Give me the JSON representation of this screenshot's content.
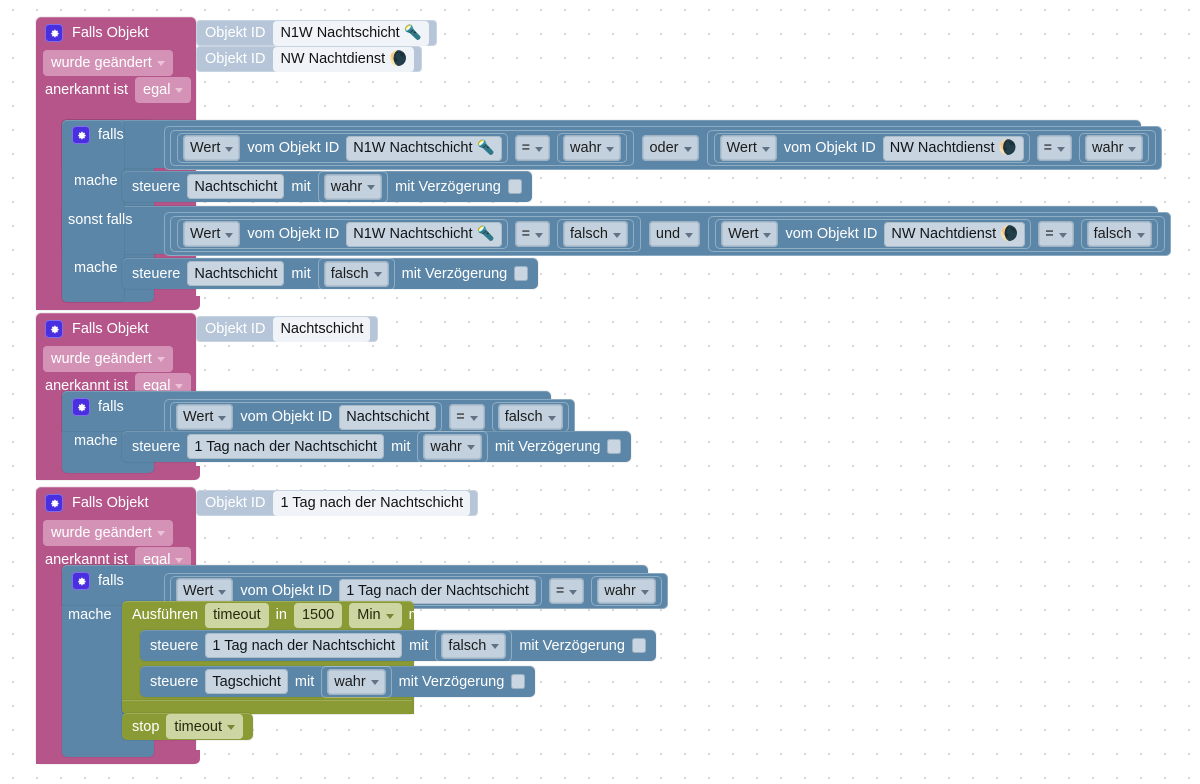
{
  "app": {
    "kind": "blockly-visual-script-editor",
    "language": "de",
    "colors": {
      "event_block": "#b5558a",
      "control_block": "#5b86a7",
      "timing_block": "#8a9b35",
      "object_block": "#b6c6d8",
      "gear_icon": "#4a2fe0",
      "canvas": "#ffffff"
    }
  },
  "labels": {
    "falls_objekt": "Falls Objekt",
    "objekt_id": "Objekt ID",
    "wurde_geaendert": "wurde geändert",
    "anerkannt_ist": "anerkannt ist",
    "falls": "falls",
    "sonst_falls": "sonst falls",
    "mache": "mache",
    "wert": "Wert",
    "vom_objekt_id": "vom Objekt ID",
    "steuere": "steuere",
    "mit": "mit",
    "mit_verzoegerung": "mit Verzögerung",
    "ausfuehren": "Ausführen",
    "in": "in",
    "ms": "ms",
    "stop": "stop",
    "egal": "egal",
    "wahr": "wahr",
    "falsch": "falsch",
    "oder": "oder",
    "und": "und",
    "equals": "=",
    "timeout": "timeout",
    "min": "Min"
  },
  "objects": {
    "n1w_nachtschicht": "N1W Nachtschicht 🔦",
    "nw_nachtdienst": "NW Nachtdienst 🌘",
    "nachtschicht": "Nachtschicht",
    "tag_nach_nachtschicht": "1 Tag nach der Nachtschicht",
    "tagschicht": "Tagschicht"
  },
  "scripts": [
    {
      "id": "script-1",
      "trigger": {
        "title": "Falls Objekt",
        "object_ids": [
          "N1W Nachtschicht 🔦",
          "NW Nachtdienst 🌘"
        ],
        "change_mode": "wurde geändert",
        "ack_label": "anerkannt ist",
        "ack_value": "egal"
      },
      "branches": [
        {
          "keyword": "falls",
          "condition": {
            "left": {
              "getter": "Wert",
              "of_label": "vom Objekt ID",
              "object": "N1W Nachtschicht 🔦"
            },
            "operator": "=",
            "right": "wahr",
            "logic_op": "oder",
            "left2": {
              "getter": "Wert",
              "of_label": "vom Objekt ID",
              "object": "NW Nachtdienst 🌘"
            },
            "operator2": "=",
            "right2": "wahr"
          },
          "do": [
            {
              "verb": "steuere",
              "target": "Nachtschicht",
              "with_label": "mit",
              "value": "wahr",
              "delay_label": "mit Verzögerung",
              "delay_checked": false
            }
          ]
        },
        {
          "keyword": "sonst falls",
          "condition": {
            "left": {
              "getter": "Wert",
              "of_label": "vom Objekt ID",
              "object": "N1W Nachtschicht 🔦"
            },
            "operator": "=",
            "right": "falsch",
            "logic_op": "und",
            "left2": {
              "getter": "Wert",
              "of_label": "vom Objekt ID",
              "object": "NW Nachtdienst 🌘"
            },
            "operator2": "=",
            "right2": "falsch"
          },
          "do": [
            {
              "verb": "steuere",
              "target": "Nachtschicht",
              "with_label": "mit",
              "value": "falsch",
              "delay_label": "mit Verzögerung",
              "delay_checked": false
            }
          ]
        }
      ]
    },
    {
      "id": "script-2",
      "trigger": {
        "title": "Falls Objekt",
        "object_ids": [
          "Nachtschicht"
        ],
        "change_mode": "wurde geändert",
        "ack_label": "anerkannt ist",
        "ack_value": "egal"
      },
      "branches": [
        {
          "keyword": "falls",
          "condition": {
            "left": {
              "getter": "Wert",
              "of_label": "vom Objekt ID",
              "object": "Nachtschicht"
            },
            "operator": "=",
            "right": "falsch"
          },
          "do": [
            {
              "verb": "steuere",
              "target": "1 Tag nach der Nachtschicht",
              "with_label": "mit",
              "value": "wahr",
              "delay_label": "mit Verzögerung",
              "delay_checked": false
            }
          ]
        }
      ]
    },
    {
      "id": "script-3",
      "trigger": {
        "title": "Falls Objekt",
        "object_ids": [
          "1 Tag nach der Nachtschicht"
        ],
        "change_mode": "wurde geändert",
        "ack_label": "anerkannt ist",
        "ack_value": "egal"
      },
      "branches": [
        {
          "keyword": "falls",
          "condition": {
            "left": {
              "getter": "Wert",
              "of_label": "vom Objekt ID",
              "object": "1 Tag nach der Nachtschicht"
            },
            "operator": "=",
            "right": "wahr"
          },
          "timeout": {
            "verb": "Ausführen",
            "name": "timeout",
            "in_label": "in",
            "duration": "1500",
            "unit": "Min",
            "unit_suffix": "ms",
            "body": [
              {
                "verb": "steuere",
                "target": "1 Tag nach der Nachtschicht",
                "with_label": "mit",
                "value": "falsch",
                "delay_label": "mit Verzögerung",
                "delay_checked": false
              },
              {
                "verb": "steuere",
                "target": "Tagschicht",
                "with_label": "mit",
                "value": "wahr",
                "delay_label": "mit Verzögerung",
                "delay_checked": false
              }
            ]
          },
          "stop": {
            "verb": "stop",
            "name": "timeout"
          }
        }
      ]
    }
  ]
}
